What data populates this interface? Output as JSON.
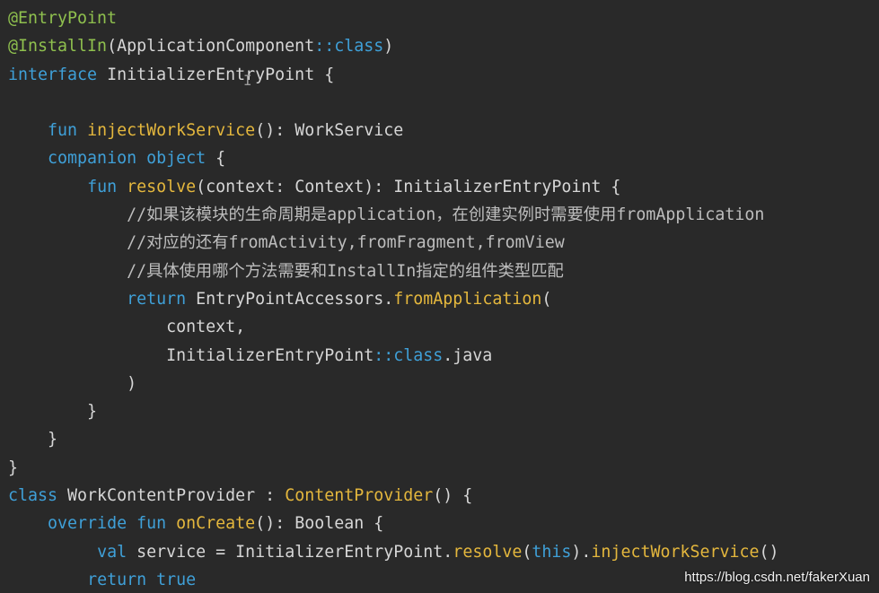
{
  "colors": {
    "background": "#292929",
    "keyword": "#3fa0d8",
    "function": "#e4b73d",
    "annotation": "#8fc04e",
    "text": "#d6d6d6",
    "comment": "#bdbdbd"
  },
  "cursor_icon": "text-cursor-icon",
  "code_lines": [
    [
      {
        "t": "an",
        "v": "@EntryPoint"
      }
    ],
    [
      {
        "t": "an",
        "v": "@InstallIn"
      },
      {
        "t": "tx",
        "v": "(ApplicationComponent"
      },
      {
        "t": "op",
        "v": "::"
      },
      {
        "t": "kw",
        "v": "class"
      },
      {
        "t": "tx",
        "v": ")"
      }
    ],
    [
      {
        "t": "kw",
        "v": "interface"
      },
      {
        "t": "tx",
        "v": " InitializerEntryPoint {"
      }
    ],
    [],
    [
      {
        "t": "tx",
        "v": "    "
      },
      {
        "t": "kw",
        "v": "fun"
      },
      {
        "t": "tx",
        "v": " "
      },
      {
        "t": "fn",
        "v": "injectWorkService"
      },
      {
        "t": "tx",
        "v": "(): WorkService"
      }
    ],
    [
      {
        "t": "tx",
        "v": "    "
      },
      {
        "t": "kw",
        "v": "companion object"
      },
      {
        "t": "tx",
        "v": " {"
      }
    ],
    [
      {
        "t": "tx",
        "v": "        "
      },
      {
        "t": "kw",
        "v": "fun"
      },
      {
        "t": "tx",
        "v": " "
      },
      {
        "t": "fn",
        "v": "resolve"
      },
      {
        "t": "tx",
        "v": "(context: Context): InitializerEntryPoint {"
      }
    ],
    [
      {
        "t": "tx",
        "v": "            "
      },
      {
        "t": "cm",
        "v": "//如果该模块的生命周期是application，在创建实例时需要使用fromApplication"
      }
    ],
    [
      {
        "t": "tx",
        "v": "            "
      },
      {
        "t": "cm",
        "v": "//对应的还有fromActivity,fromFragment,fromView"
      }
    ],
    [
      {
        "t": "tx",
        "v": "            "
      },
      {
        "t": "cm",
        "v": "//具体使用哪个方法需要和InstallIn指定的组件类型匹配"
      }
    ],
    [
      {
        "t": "tx",
        "v": "            "
      },
      {
        "t": "kw",
        "v": "return"
      },
      {
        "t": "tx",
        "v": " EntryPointAccessors."
      },
      {
        "t": "fn",
        "v": "fromApplication"
      },
      {
        "t": "tx",
        "v": "("
      }
    ],
    [
      {
        "t": "tx",
        "v": "                context,"
      }
    ],
    [
      {
        "t": "tx",
        "v": "                InitializerEntryPoint"
      },
      {
        "t": "op",
        "v": "::"
      },
      {
        "t": "kw",
        "v": "class"
      },
      {
        "t": "tx",
        "v": ".java"
      }
    ],
    [
      {
        "t": "tx",
        "v": "            )"
      }
    ],
    [
      {
        "t": "tx",
        "v": "        }"
      }
    ],
    [
      {
        "t": "tx",
        "v": "    }"
      }
    ],
    [
      {
        "t": "tx",
        "v": "}"
      }
    ],
    [
      {
        "t": "kw",
        "v": "class"
      },
      {
        "t": "tx",
        "v": " WorkContentProvider : "
      },
      {
        "t": "fn",
        "v": "ContentProvider"
      },
      {
        "t": "tx",
        "v": "() {"
      }
    ],
    [
      {
        "t": "tx",
        "v": "    "
      },
      {
        "t": "kw",
        "v": "override fun"
      },
      {
        "t": "tx",
        "v": " "
      },
      {
        "t": "fn",
        "v": "onCreate"
      },
      {
        "t": "tx",
        "v": "(): Boolean {"
      }
    ],
    [
      {
        "t": "tx",
        "v": "         "
      },
      {
        "t": "kw",
        "v": "val"
      },
      {
        "t": "tx",
        "v": " service = InitializerEntryPoint."
      },
      {
        "t": "fn",
        "v": "resolve"
      },
      {
        "t": "tx",
        "v": "("
      },
      {
        "t": "kw",
        "v": "this"
      },
      {
        "t": "tx",
        "v": ")."
      },
      {
        "t": "fn",
        "v": "injectWorkService"
      },
      {
        "t": "tx",
        "v": "()"
      }
    ],
    [
      {
        "t": "tx",
        "v": "        "
      },
      {
        "t": "kw",
        "v": "return true"
      }
    ]
  ],
  "watermark": "https://blog.csdn.net/fakerXuan"
}
